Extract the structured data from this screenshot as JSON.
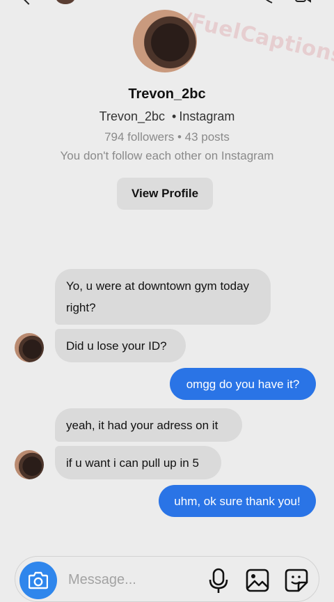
{
  "watermark": "u/FuelCaptions",
  "profile": {
    "name": "Trevon_2bc",
    "username": "Trevon_2bc",
    "platform": "Instagram",
    "stats": "794 followers • 43 posts",
    "follow_status": "You don't follow each other on Instagram",
    "view_profile_label": "View Profile"
  },
  "messages": [
    {
      "from": "them",
      "text": "Yo, u were at downtown gym today right?"
    },
    {
      "from": "them",
      "text": "Did u lose your ID?"
    },
    {
      "from": "me",
      "text": "omgg do you have it?"
    },
    {
      "from": "them",
      "text": "yeah, it had your adress on it"
    },
    {
      "from": "them",
      "text": "if u want i can pull up in 5"
    },
    {
      "from": "me",
      "text": "uhm, ok sure thank you!"
    }
  ],
  "composer": {
    "placeholder": "Message...",
    "icons": [
      "camera-icon",
      "microphone-icon",
      "image-gallery-icon",
      "sticker-icon"
    ]
  },
  "colors": {
    "background": "#ececec",
    "incoming_bubble": "#dadada",
    "outgoing_bubble": "#2a74e6",
    "camera_button": "#2f86ec"
  }
}
